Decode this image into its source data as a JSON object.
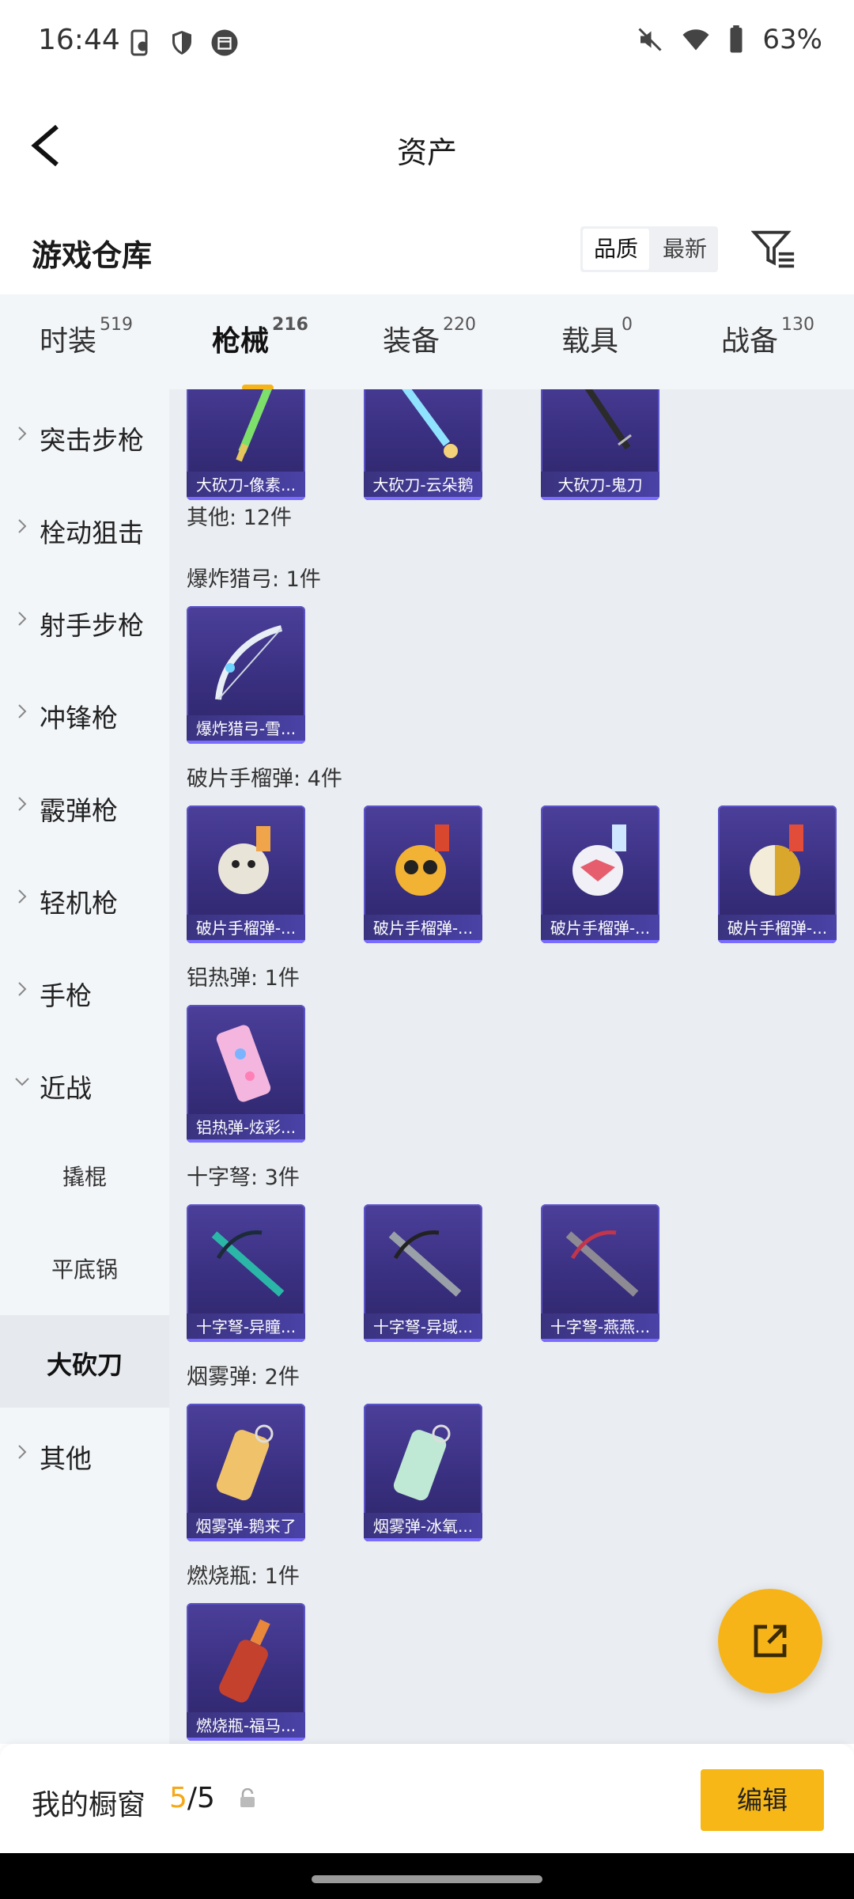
{
  "status_bar": {
    "time": "16:44",
    "battery": "63%",
    "left_icons": [
      "phone-screen-icon",
      "shield-icon",
      "calendar-icon"
    ],
    "right_icons": [
      "mute-icon",
      "wifi-icon",
      "battery-icon"
    ]
  },
  "nav": {
    "title": "资产",
    "back_icon": "back-arrow-icon"
  },
  "section": {
    "title": "游戏仓库",
    "sort_options": [
      "品质",
      "最新"
    ],
    "sort_selected": "品质",
    "filter_icon": "filter-icon"
  },
  "tabs": [
    {
      "label": "时装",
      "count": "519"
    },
    {
      "label": "枪械",
      "count": "216",
      "active": true
    },
    {
      "label": "装备",
      "count": "220"
    },
    {
      "label": "载具",
      "count": "0"
    },
    {
      "label": "战备",
      "count": "130"
    }
  ],
  "sidebar": {
    "items": [
      {
        "label": "突击步枪"
      },
      {
        "label": "栓动狙击"
      },
      {
        "label": "射手步枪"
      },
      {
        "label": "冲锋枪"
      },
      {
        "label": "霰弹枪"
      },
      {
        "label": "轻机枪"
      },
      {
        "label": "手枪"
      },
      {
        "label": "近战",
        "expanded": true
      },
      {
        "label": "撬棍",
        "sub": true
      },
      {
        "label": "平底锅",
        "sub": true
      },
      {
        "label": "大砍刀",
        "sub": true,
        "selected": true
      },
      {
        "label": "其他"
      }
    ]
  },
  "content": {
    "top_items": [
      "大砍刀-像素...",
      "大砍刀-云朵鹅",
      "大砍刀-鬼刀"
    ],
    "other_header": "其他: 12件",
    "groups": [
      {
        "header": "爆炸猎弓: 1件",
        "items": [
          "爆炸猎弓-雪..."
        ]
      },
      {
        "header": "破片手榴弹: 4件",
        "items": [
          "破片手榴弹-...",
          "破片手榴弹-...",
          "破片手榴弹-...",
          "破片手榴弹-..."
        ]
      },
      {
        "header": "铝热弹: 1件",
        "items": [
          "铝热弹-炫彩..."
        ]
      },
      {
        "header": "十字弩: 3件",
        "items": [
          "十字弩-异瞳...",
          "十字弩-异域...",
          "十字弩-燕燕..."
        ]
      },
      {
        "header": "烟雾弹: 2件",
        "items": [
          "烟雾弹-鹅来了",
          "烟雾弹-冰氧..."
        ]
      },
      {
        "header": "燃烧瓶: 1件",
        "items": [
          "燃烧瓶-福马..."
        ]
      }
    ]
  },
  "fab": {
    "icon": "share-external-icon"
  },
  "bottom": {
    "label": "我的橱窗",
    "current": "5",
    "separator": "/",
    "total": "5",
    "lock_icon": "lock-icon",
    "edit_label": "编辑"
  },
  "colors": {
    "accent": "#f7b716",
    "card_bg": "#392f7f",
    "page_bg": "#eaedf1"
  }
}
